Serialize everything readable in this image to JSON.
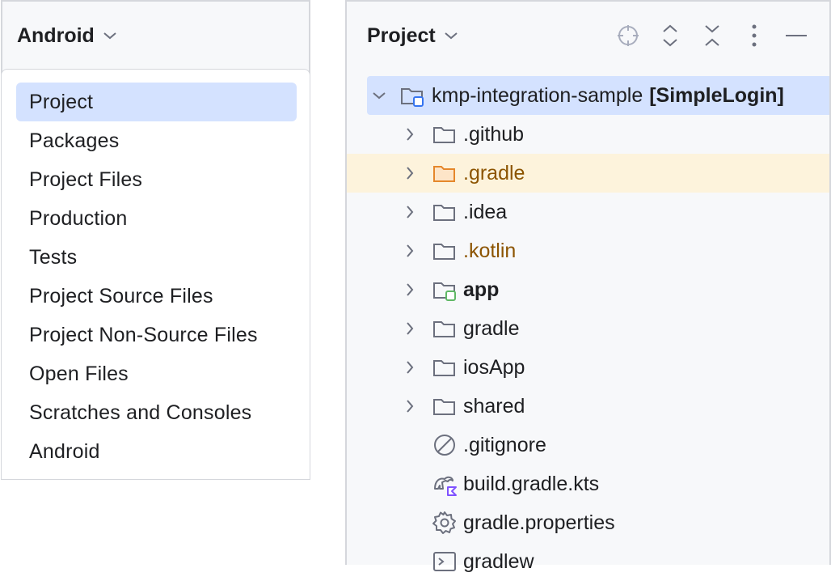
{
  "left": {
    "title": "Android",
    "menu": [
      {
        "label": "Project",
        "selected": true
      },
      {
        "label": "Packages"
      },
      {
        "label": "Project Files"
      },
      {
        "label": "Production"
      },
      {
        "label": "Tests"
      },
      {
        "label": "Project Source Files"
      },
      {
        "label": "Project Non-Source Files"
      },
      {
        "label": "Open Files"
      },
      {
        "label": "Scratches and Consoles"
      },
      {
        "label": "Android"
      }
    ]
  },
  "right": {
    "title": "Project",
    "toolbar": [
      "locate-icon",
      "expand-all-icon",
      "collapse-all-icon",
      "more-options-icon",
      "minimize-icon"
    ],
    "tree": {
      "root": {
        "name": "kmp-integration-sample",
        "module": "[SimpleLogin]"
      },
      "items": [
        {
          "name": ".github"
        },
        {
          "name": ".gradle"
        },
        {
          "name": ".idea"
        },
        {
          "name": ".kotlin"
        },
        {
          "name": "app"
        },
        {
          "name": "gradle"
        },
        {
          "name": "iosApp"
        },
        {
          "name": "shared"
        },
        {
          "name": ".gitignore"
        },
        {
          "name": "build.gradle.kts"
        },
        {
          "name": "gradle.properties"
        },
        {
          "name": "gradlew"
        }
      ]
    }
  },
  "colors": {
    "selection": "#d4e2ff",
    "highlight_row": "#fdf3dc",
    "excluded_text": "#8c5400",
    "module_badge_blue": "#3574f0",
    "module_badge_green": "#5fb865",
    "kotlin_purple": "#7f52ff"
  }
}
